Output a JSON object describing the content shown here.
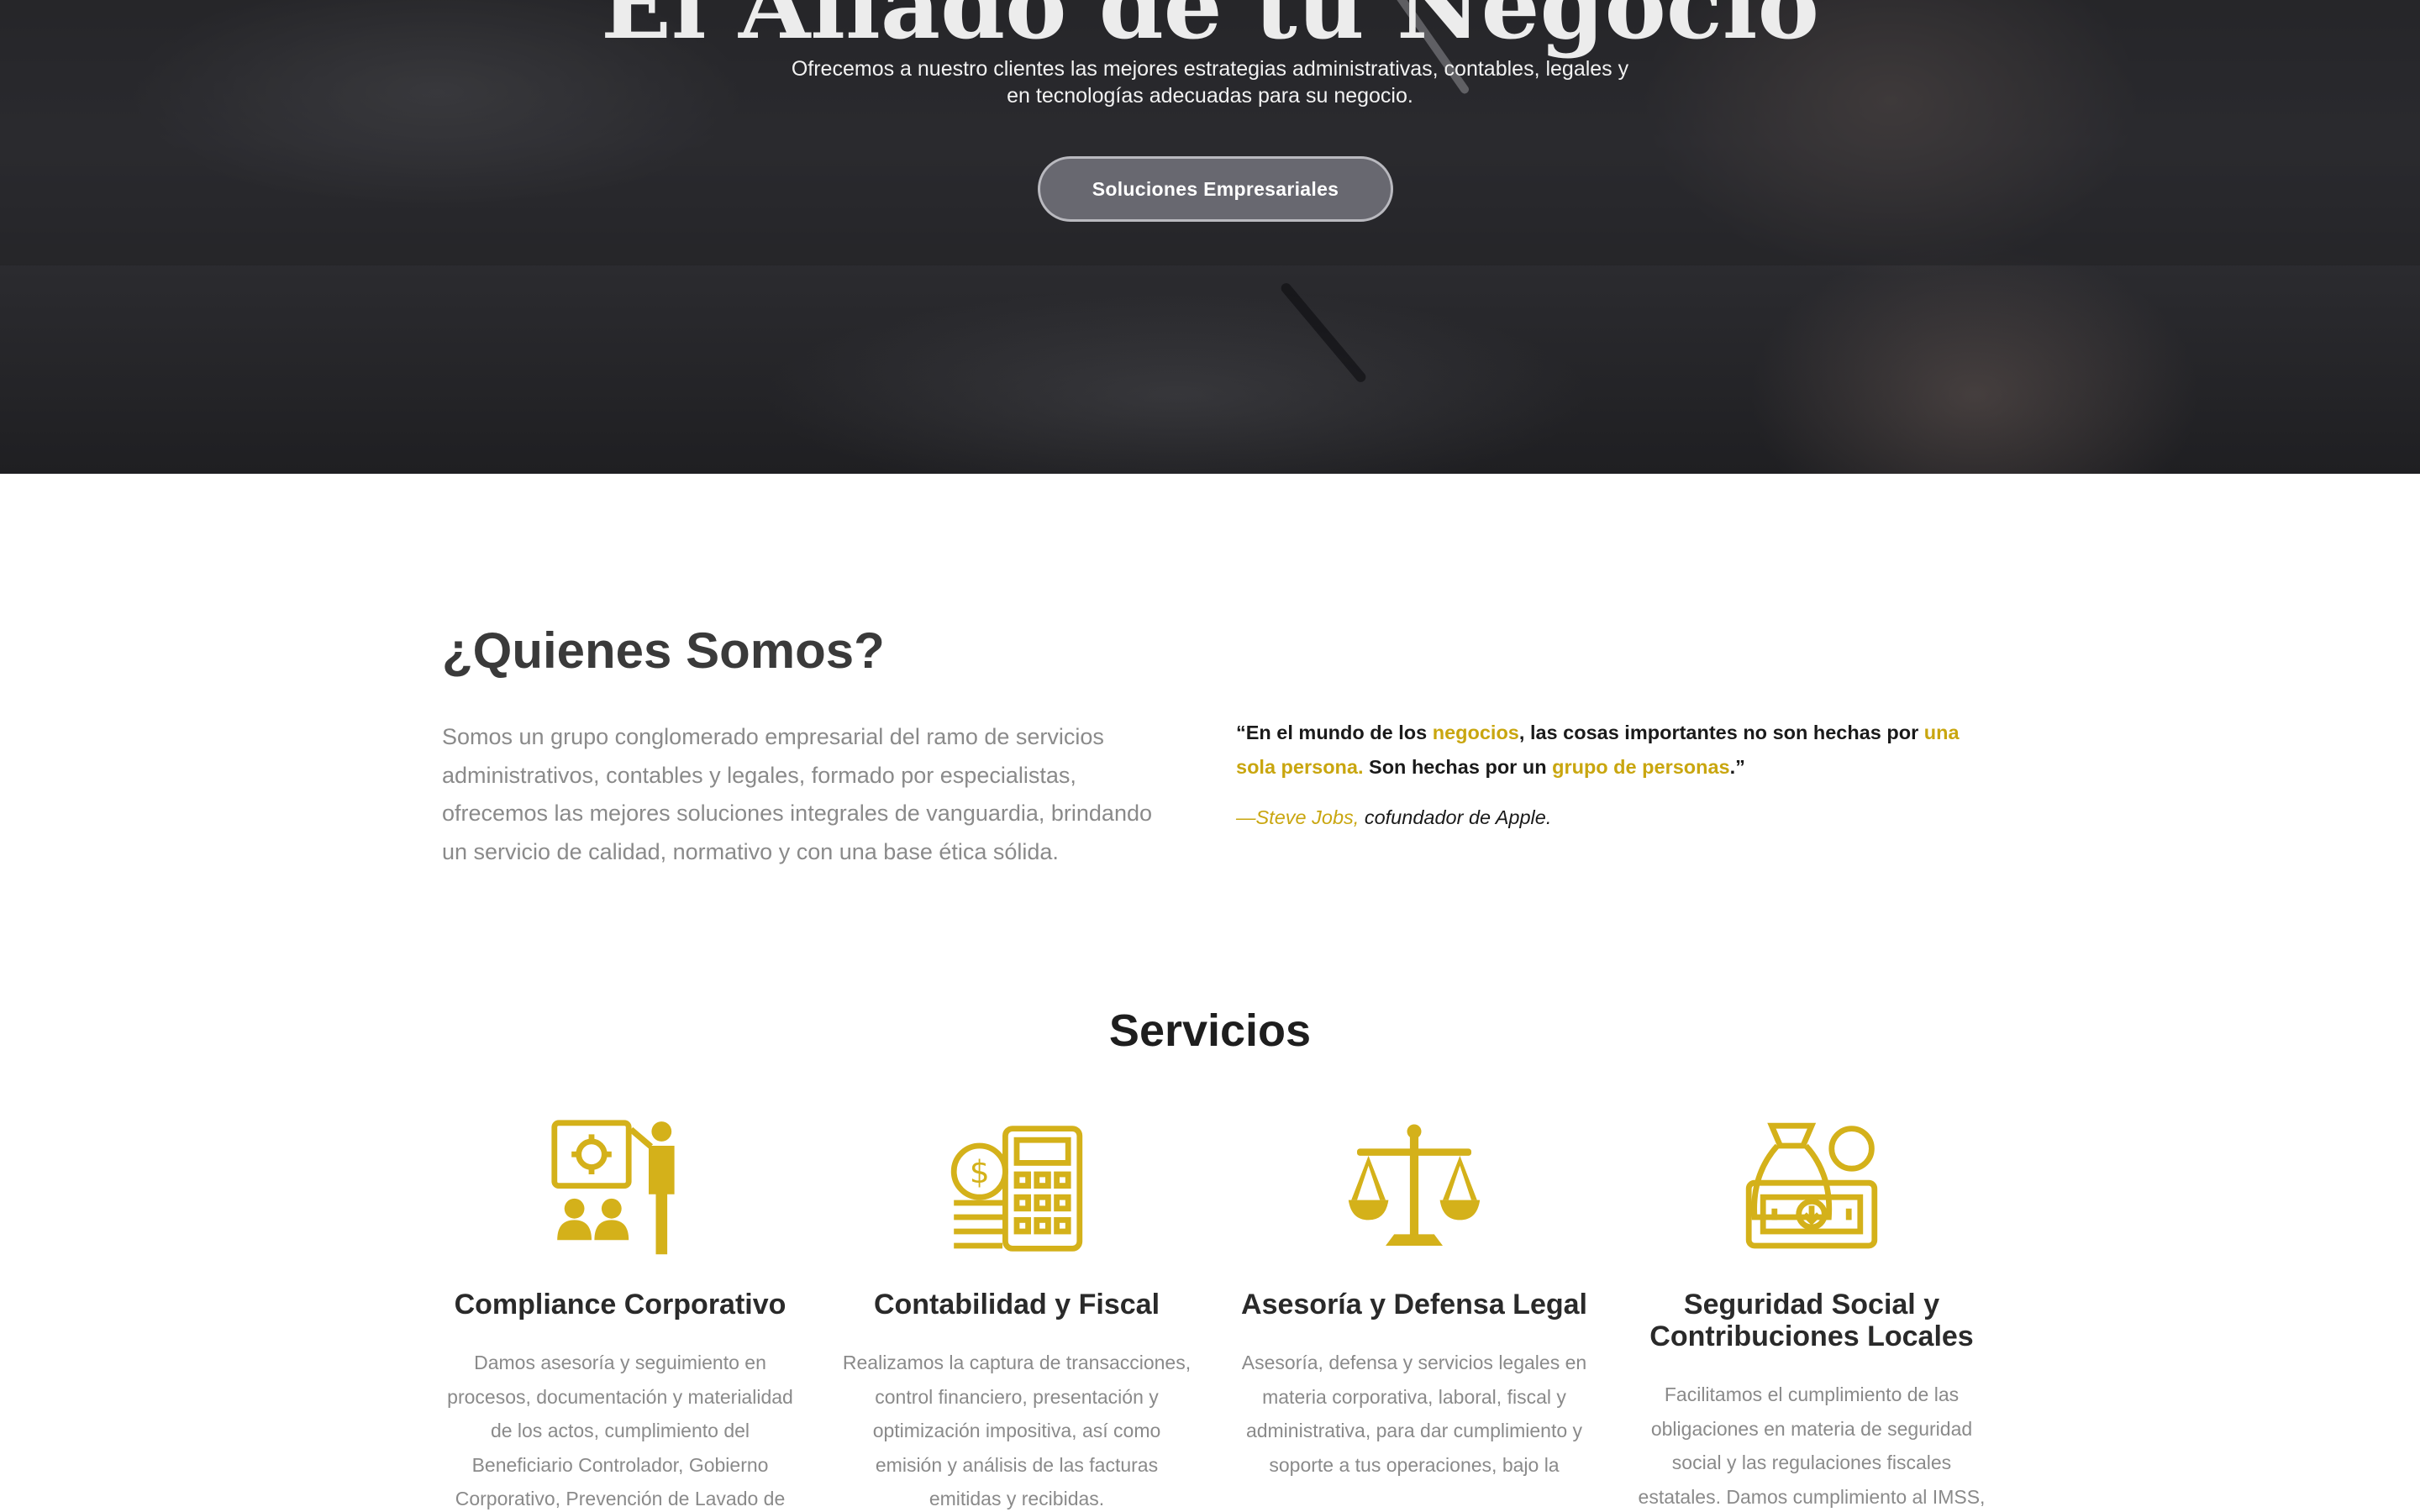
{
  "colors": {
    "accent": "#c9a60f",
    "hero_bg": "#2c2c30",
    "heading": "#2a2a2a",
    "body_text": "#8a8a8a"
  },
  "hero": {
    "title": "El Aliado de tu Negocio",
    "subtitle": "Ofrecemos a nuestro clientes las mejores estrategias administrativas, contables, legales y en tecnologías adecuadas para su negocio.",
    "cta_label": "Soluciones Empresariales"
  },
  "about": {
    "title": "¿Quienes Somos?",
    "text": "Somos un grupo conglomerado empresarial del ramo de servicios administrativos, contables y legales, formado por especialistas, ofrecemos las mejores soluciones integrales de vanguardia, brindando un servicio de calidad, normativo y con una base ética sólida.",
    "quote": {
      "open": "“En el mundo de los ",
      "hl1": "negocios",
      "mid1": ", las cosas importantes no son hechas por ",
      "hl2": "una sola persona.",
      "mid2": " Son hechas por un ",
      "hl3": "grupo de personas",
      "close": ".”",
      "author": "—Steve Jobs,",
      "author_role": " cofundador de Apple."
    }
  },
  "services": {
    "title": "Servicios",
    "items": [
      {
        "icon": "presentation-team-icon",
        "title": "Compliance Corporativo",
        "text": "Damos asesoría y seguimiento en procesos, documentación y materialidad de los actos, cumplimiento del Beneficiario Controlador, Gobierno Corporativo, Prevención de Lavado de"
      },
      {
        "icon": "calculator-coins-icon",
        "title": "Contabilidad y Fiscal",
        "text": "Realizamos la captura de transacciones, control financiero, presentación y optimización impositiva, así como emisión y análisis de las facturas emitidas y recibidas."
      },
      {
        "icon": "scales-of-justice-icon",
        "title": "Asesoría y Defensa Legal",
        "text": "Asesoría, defensa y servicios legales en materia corporativa, laboral, fiscal y administrativa, para dar cumplimiento y soporte a tus operaciones, bajo la"
      },
      {
        "icon": "money-bag-icon",
        "title": "Seguridad Social y Contribuciones Locales",
        "text": "Facilitamos el cumplimiento de las obligaciones en materia de seguridad social y las regulaciones fiscales estatales. Damos cumplimiento al IMSS,"
      }
    ]
  }
}
